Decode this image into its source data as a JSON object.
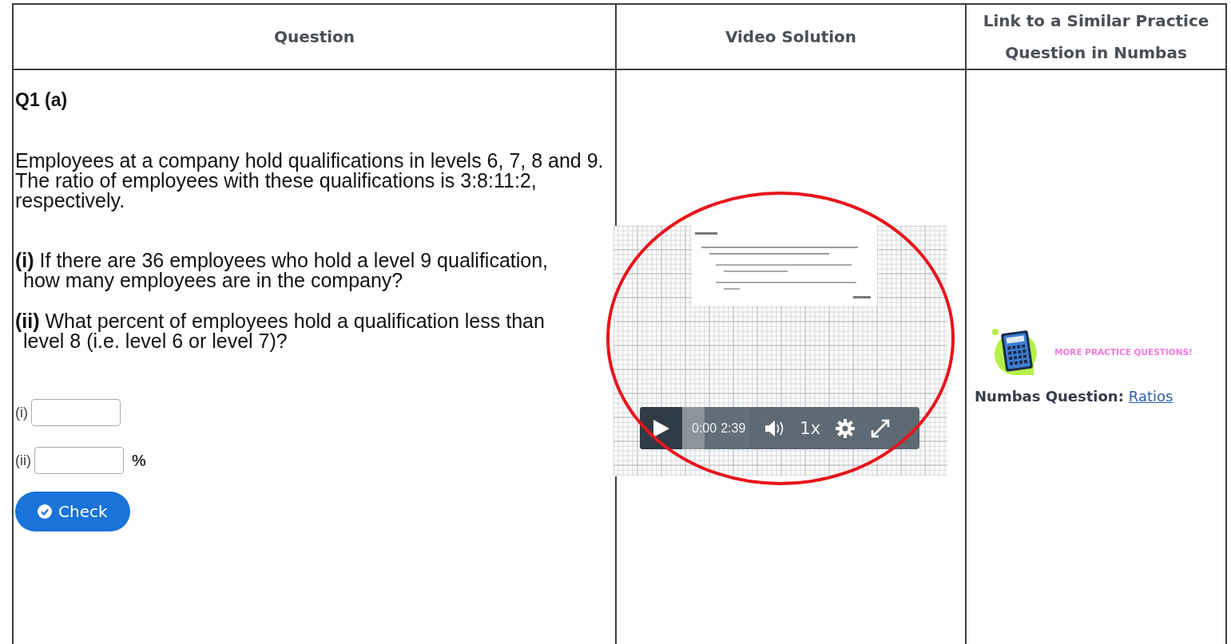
{
  "table": {
    "columns": [
      "Question",
      "Video Solution",
      "Link to a Similar Practice Question in Numbas"
    ],
    "question": {
      "title": "Q1 (a)",
      "intro": "Employees at a company hold qualifications in levels 6, 7, 8 and 9. The ratio of employees with these qualifications is 3:8:11:2, respectively.",
      "parts": [
        {
          "text": "**(i)** If there are 36 employees who hold a level 9 qualification, how many employees are in the company?"
        },
        {
          "text": "**(ii)** What percent of employees hold a qualification less than level 8 (i.e. level 6 or level 7)?"
        }
      ],
      "answers": [
        {
          "label": "(i)"
        },
        {
          "label": "(ii)",
          "unit": "%"
        }
      ],
      "button": "Check"
    },
    "video": {
      "kind": "picture",
      "elapsed": "0:00",
      "duration": "2:39",
      "speed": "1x"
    },
    "practice": {
      "banner": "MORE PRACTICE QUESTIONS!",
      "label": "Numbas Question:",
      "link": "Ratios"
    }
  }
}
